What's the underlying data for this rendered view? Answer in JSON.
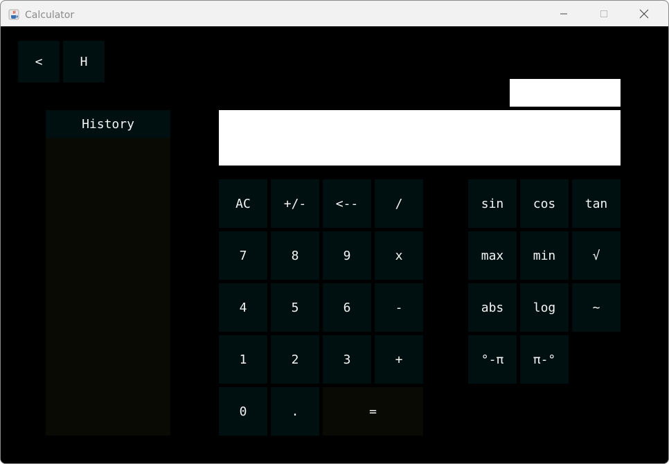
{
  "window": {
    "title": "Calculator",
    "icon": "java-cup-icon",
    "controls": [
      "minimize-icon",
      "maximize-icon",
      "close-icon"
    ]
  },
  "nav": {
    "back_label": "<",
    "history_label": "H"
  },
  "history": {
    "header": "History"
  },
  "display": {
    "secondary_value": "",
    "main_value": ""
  },
  "keypad": {
    "ac": "AC",
    "negate": "+/-",
    "backspace": "<--",
    "divide": "/",
    "seven": "7",
    "eight": "8",
    "nine": "9",
    "multiply": "x",
    "four": "4",
    "five": "5",
    "six": "6",
    "minus": "-",
    "one": "1",
    "two": "2",
    "three": "3",
    "plus": "+",
    "zero": "0",
    "dot": ".",
    "equals": "="
  },
  "scientific": {
    "sin": "sin",
    "cos": "cos",
    "tan": "tan",
    "max": "max",
    "min": "min",
    "sqrt": "√",
    "abs": "abs",
    "log": "log",
    "tilde": "~",
    "deg_to_pi": "°-π",
    "pi_to_deg": "π-°"
  },
  "colors": {
    "background": "#000000",
    "button": "#001010",
    "history_panel": "#0a0a04",
    "button_text": "#f4f4f4",
    "display": "#ffffff",
    "titlebar": "#f2f2f2"
  }
}
